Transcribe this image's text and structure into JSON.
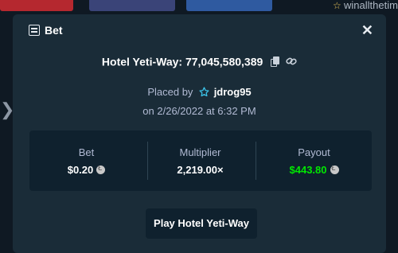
{
  "background": {
    "top_right_text": "winallthetime"
  },
  "modal": {
    "title": "Bet",
    "game_name": "Hotel Yeti-Way:",
    "bet_id": "77,045,580,389",
    "placed_by_label": "Placed by",
    "username": "jdrog95",
    "date_text": "on 2/26/2022 at 6:32 PM",
    "stats": {
      "bet_label": "Bet",
      "bet_value": "$0.20",
      "multiplier_label": "Multiplier",
      "multiplier_value": "2,219.00×",
      "payout_label": "Payout",
      "payout_value": "$443.80"
    },
    "play_button": "Play Hotel Yeti-Way"
  },
  "colors": {
    "payout_green": "#00e701",
    "vip_star": "#3bc1e6"
  }
}
